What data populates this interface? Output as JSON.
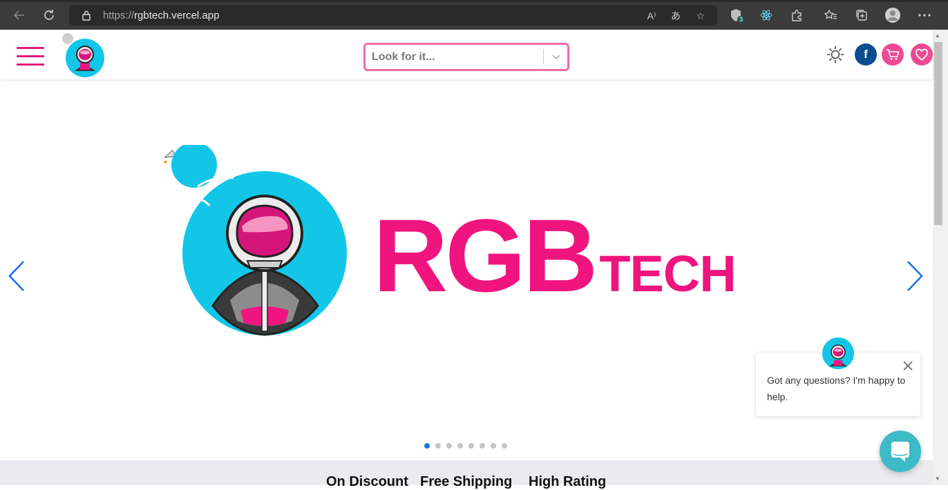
{
  "browser": {
    "url_protocol": "https://",
    "url_host": "rgbtech.vercel.app",
    "extension_badge": "3"
  },
  "header": {
    "search_placeholder": "Look for it...",
    "facebook_label": "f",
    "accent_color": "#e3197c"
  },
  "banner": {
    "brand_big": "RGB",
    "brand_small": "TECH",
    "slide_count": 8,
    "active_slide": 1
  },
  "features": {
    "items": [
      "On Discount",
      "Free Shipping",
      "High Rating"
    ]
  },
  "chat": {
    "message": "Got any questions? I'm happy to help."
  }
}
